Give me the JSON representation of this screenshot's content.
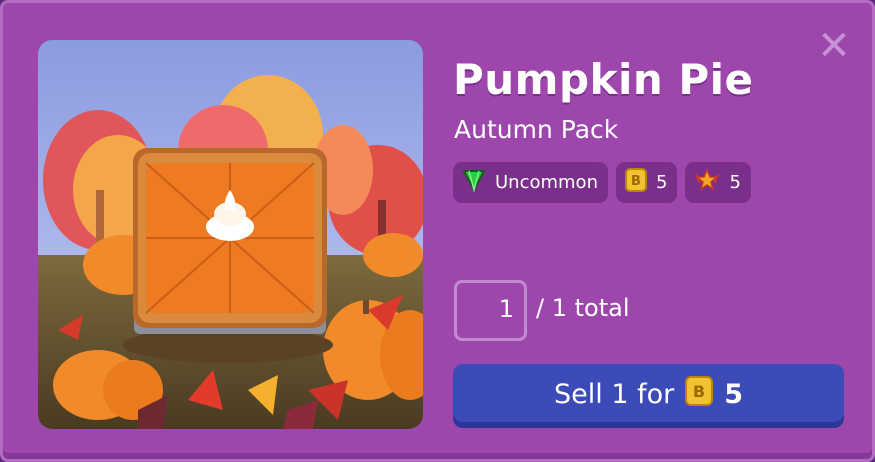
{
  "item": {
    "name": "Pumpkin Pie",
    "pack": "Autumn Pack",
    "artwork_icon": "pumpkin-pie-illustration"
  },
  "badges": {
    "rarity": {
      "label": "Uncommon",
      "icon": "green-gem-icon",
      "color": "#2ecc40"
    },
    "coin_value": {
      "value": "5",
      "icon": "blook-coin-icon",
      "color": "#f2c230"
    },
    "xp_value": {
      "value": "5",
      "icon": "winged-star-icon",
      "color": "#e8382b"
    }
  },
  "quantity": {
    "value": "1",
    "total_text": "/ 1 total"
  },
  "sell_button": {
    "label": "Sell 1 for",
    "price": "5",
    "icon": "blook-coin-icon"
  },
  "close_icon": "close-icon",
  "colors": {
    "panel": "#9d47ad",
    "button": "#3c4bb8",
    "badge_bg": "#7a2f8b"
  }
}
